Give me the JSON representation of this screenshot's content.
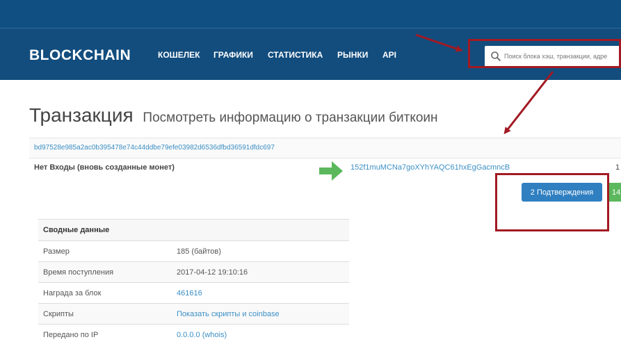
{
  "header": {
    "logo": "BLOCKCHAIN",
    "nav": [
      "КОШЕЛЕК",
      "ГРАФИКИ",
      "СТАТИСТИКА",
      "РЫНКИ",
      "API"
    ],
    "search_placeholder": "Поиск блока хэш, транзакции, адре"
  },
  "page": {
    "title": "Транзакция",
    "subtitle": "Посмотреть информацию о транзакции биткоин"
  },
  "transaction": {
    "hash": "bd97528e985a2ac0b395478e74c44ddbe79efe03982d6536dfbd36591dfdc697",
    "inputs_label": "Нет Входы (вновь созданные монет)",
    "output_address": "152f1muMCNa7goXYhYAQC61hxEgGacmncB",
    "output_amount_cut": "1",
    "confirmations_label": "2 Подтверждения",
    "amount_button_cut": "14"
  },
  "summary": {
    "header": "Сводные данные",
    "rows": [
      {
        "label": "Размер",
        "value": "185 (байтов)",
        "link": false
      },
      {
        "label": "Время поступления",
        "value": "2017-04-12 19:10:16",
        "link": false
      },
      {
        "label": "Награда за блок",
        "value": "461616",
        "link": true
      },
      {
        "label": "Скрипты",
        "value": "Показать скрипты и coinbase",
        "link": true
      },
      {
        "label": "Передано по IP",
        "value": "0.0.0.0 (whois)",
        "link": true
      }
    ]
  },
  "colors": {
    "header_bg": "#124d7e",
    "link": "#3b8fc4",
    "confirm_button": "#2f7fc1",
    "amount_button": "#5bb85d",
    "annotation_red": "#a21a23"
  }
}
